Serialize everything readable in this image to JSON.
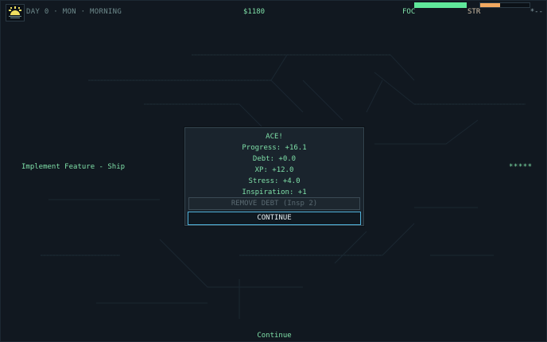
{
  "hud": {
    "day_label": "DAY 0 · MON · MORNING",
    "money": "$1180",
    "focus_label": "FOC",
    "focus_level": 1.0,
    "stress_label": "STR",
    "stress_level": 0.4,
    "right_indicator": "*--",
    "colors": {
      "focus": "#5fe89a",
      "stress": "#f0a860"
    }
  },
  "task": {
    "label": "Implement Feature - Ship",
    "rating": "*****"
  },
  "dialog": {
    "lines": [
      "ACE!",
      "Progress: +16.1",
      "Debt: +0.0",
      "XP: +12.0",
      "Stress: +4.0",
      "Inspiration: +1"
    ],
    "remove_debt_label": "REMOVE DEBT (Insp 2)",
    "continue_label": "CONTINUE"
  },
  "footer": {
    "continue_label": "Continue"
  },
  "icons": {
    "logo": "sunrise-logo-icon"
  }
}
